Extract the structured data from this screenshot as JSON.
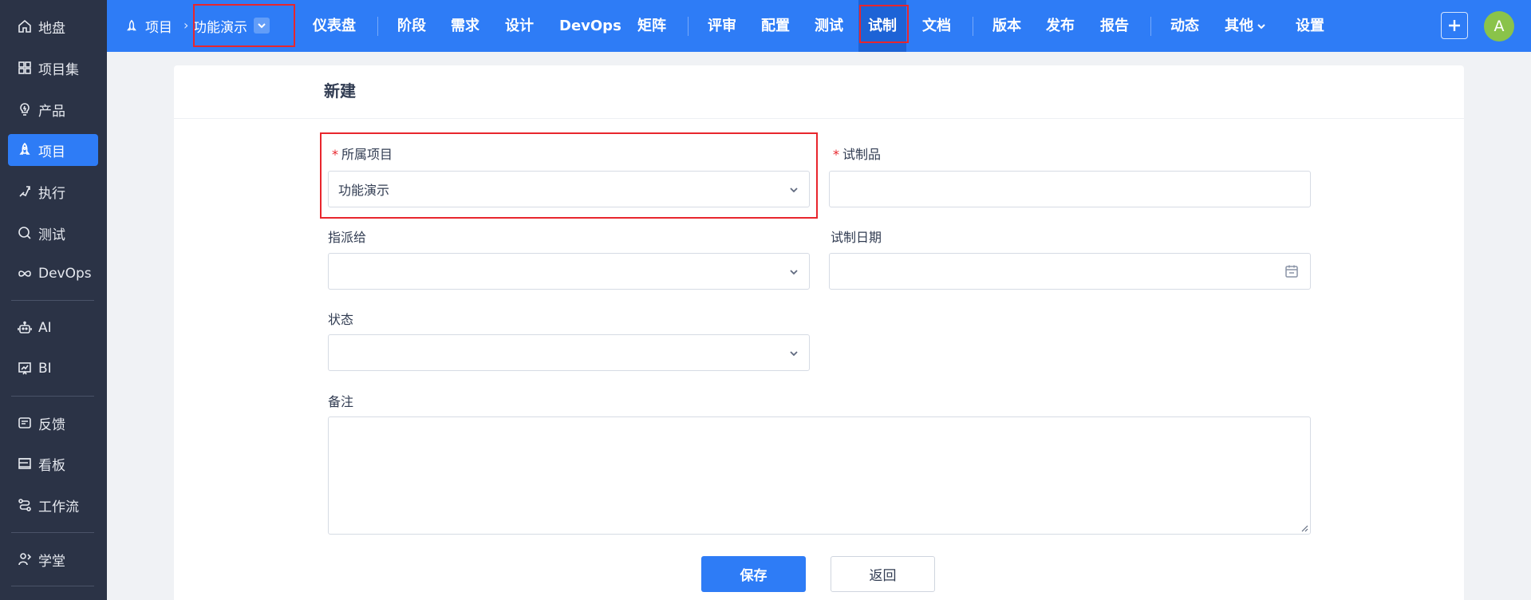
{
  "sidebar": {
    "items": [
      {
        "label": "地盘",
        "icon": "home-icon"
      },
      {
        "label": "项目集",
        "icon": "grid-icon"
      },
      {
        "label": "产品",
        "icon": "lightbulb-icon"
      },
      {
        "label": "项目",
        "icon": "rocket-icon",
        "active": true
      },
      {
        "label": "执行",
        "icon": "run-icon"
      },
      {
        "label": "测试",
        "icon": "search-check-icon"
      },
      {
        "label": "DevOps",
        "icon": "infinity-icon"
      },
      {
        "label": "AI",
        "icon": "robot-icon"
      },
      {
        "label": "BI",
        "icon": "chart-board-icon"
      },
      {
        "label": "反馈",
        "icon": "feedback-icon"
      },
      {
        "label": "看板",
        "icon": "kanban-icon"
      },
      {
        "label": "工作流",
        "icon": "workflow-icon"
      },
      {
        "label": "学堂",
        "icon": "school-icon"
      }
    ]
  },
  "topbar": {
    "breadcrumb_root": "项目",
    "current_project": "功能演示",
    "tabs": [
      "仪表盘",
      "阶段",
      "需求",
      "设计",
      "DevOps",
      "矩阵",
      "评审",
      "配置",
      "测试",
      "试制",
      "文档",
      "版本",
      "发布",
      "报告",
      "动态",
      "其他",
      "设置"
    ],
    "active_tab": "试制",
    "avatar_letter": "A",
    "accent_color": "#2e7cf6",
    "highlight_color": "#e8262d"
  },
  "form": {
    "title": "新建",
    "project_label": "所属项目",
    "project_value": "功能演示",
    "trial_label": "试制品",
    "trial_value": "",
    "assign_label": "指派给",
    "assign_value": "",
    "date_label": "试制日期",
    "date_value": "",
    "status_label": "状态",
    "status_value": "",
    "notes_label": "备注",
    "save_label": "保存",
    "back_label": "返回"
  }
}
